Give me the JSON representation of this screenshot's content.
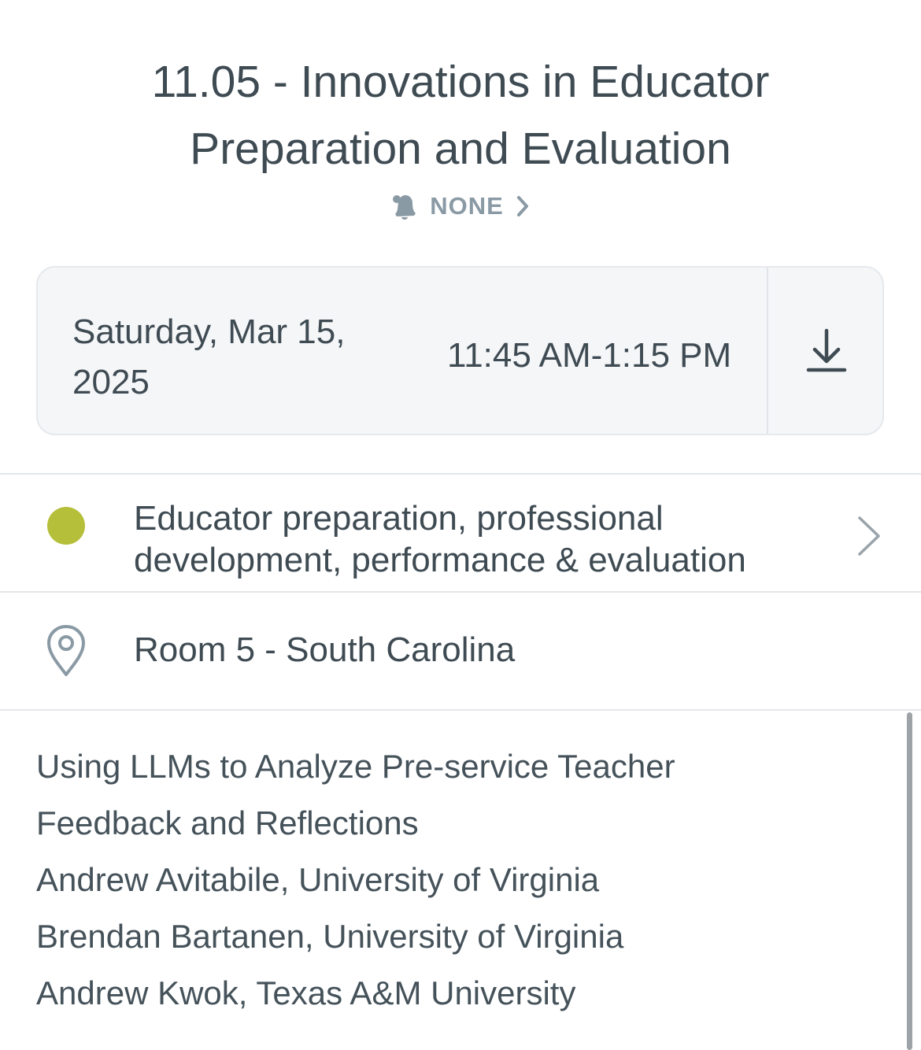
{
  "session": {
    "title": "11.05 - Innovations in Educator Preparation and Evaluation"
  },
  "reminder": {
    "label": "NONE",
    "icon": "bell-icon"
  },
  "schedule": {
    "date": "Saturday, Mar 15, 2025",
    "time": "11:45 AM-1:15 PM",
    "download_icon": "download-icon"
  },
  "track": {
    "label": "Educator preparation, professional development, performance & evaluation",
    "color": "#b6bf3a"
  },
  "location": {
    "room": "Room 5 - South Carolina",
    "icon": "map-pin-icon"
  },
  "description": {
    "lines": [
      "Using LLMs to Analyze Pre-service Teacher",
      "Feedback and Reflections",
      "Andrew Avitabile, University of Virginia",
      "Brendan Bartanen, University of Virginia",
      "Andrew Kwok, Texas A&M University"
    ]
  },
  "colors": {
    "text": "#3f4b53",
    "muted": "#8a9aa5",
    "card_bg": "#f5f6f8",
    "divider": "#e3e6e9"
  }
}
